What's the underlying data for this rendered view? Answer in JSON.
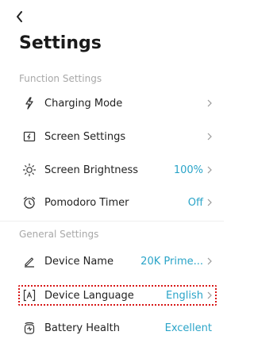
{
  "header": {
    "title": "Settings"
  },
  "sections": {
    "function": "Function Settings",
    "general": "General Settings"
  },
  "rows": {
    "charging_mode": {
      "label": "Charging Mode"
    },
    "screen_settings": {
      "label": "Screen Settings"
    },
    "screen_brightness": {
      "label": "Screen Brightness",
      "value": "100%"
    },
    "pomodoro_timer": {
      "label": "Pomodoro Timer",
      "value": "Off"
    },
    "device_name": {
      "label": "Device Name",
      "value": "20K Prime..."
    },
    "device_language": {
      "label": "Device Language",
      "value": "English"
    },
    "battery_health": {
      "label": "Battery Health",
      "value": "Excellent"
    }
  },
  "colors": {
    "accent": "#2aa4c8",
    "highlight": "#d81818"
  },
  "icons": [
    "back-arrow-icon",
    "lightning-icon",
    "screen-icon",
    "brightness-icon",
    "alarm-clock-icon",
    "pen-icon",
    "language-icon",
    "battery-health-icon",
    "chevron-right-icon"
  ]
}
